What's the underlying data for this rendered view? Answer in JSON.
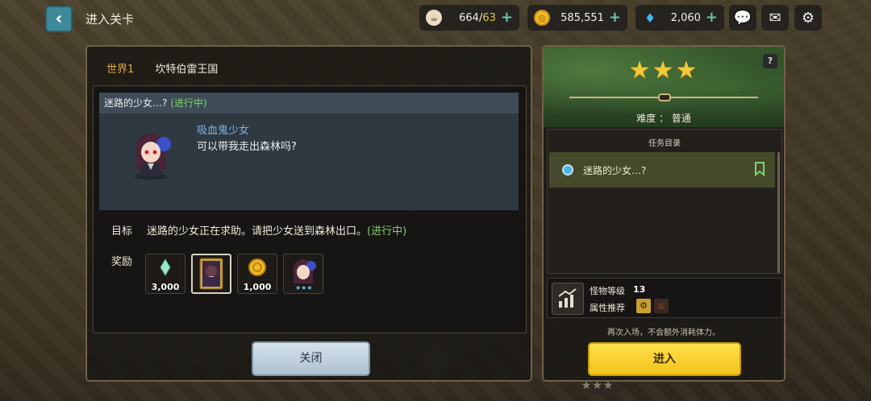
{
  "header": {
    "title": "进入关卡",
    "stamina": {
      "current": "664",
      "max": "63"
    },
    "gold": "585,551",
    "gems": "2,060"
  },
  "left_panel": {
    "world_label": "世界1",
    "world_name": "坎特伯雷王国",
    "quest_title": "迷路的少女…?",
    "quest_status": "(进行中)",
    "npc_name": "吸血鬼少女",
    "npc_dialog": "可以带我走出森林吗?",
    "objective_label": "目标",
    "objective_text": "迷路的少女正在求助。请把少女送到森林出口。",
    "objective_status": "(进行中)",
    "reward_label": "奖励",
    "rewards": [
      {
        "amount": "3,000",
        "icon": "crystal-icon"
      },
      {
        "amount": "",
        "icon": "character-card-icon"
      },
      {
        "amount": "1,000",
        "icon": "gold-coin-icon"
      },
      {
        "amount": "",
        "icon": "character-icon"
      }
    ],
    "close_label": "关闭"
  },
  "right_panel": {
    "stars": "★★★",
    "help": "?",
    "difficulty": "难度 ： 普通",
    "task_list_title": "任务目录",
    "task_item": "迷路的少女…?",
    "monster_level_label": "怪物等级",
    "monster_level": "13",
    "attribute_label": "属性推荐",
    "reentry_note": "再次入场，不会额外消耗体力。",
    "enter_label": "进入"
  }
}
